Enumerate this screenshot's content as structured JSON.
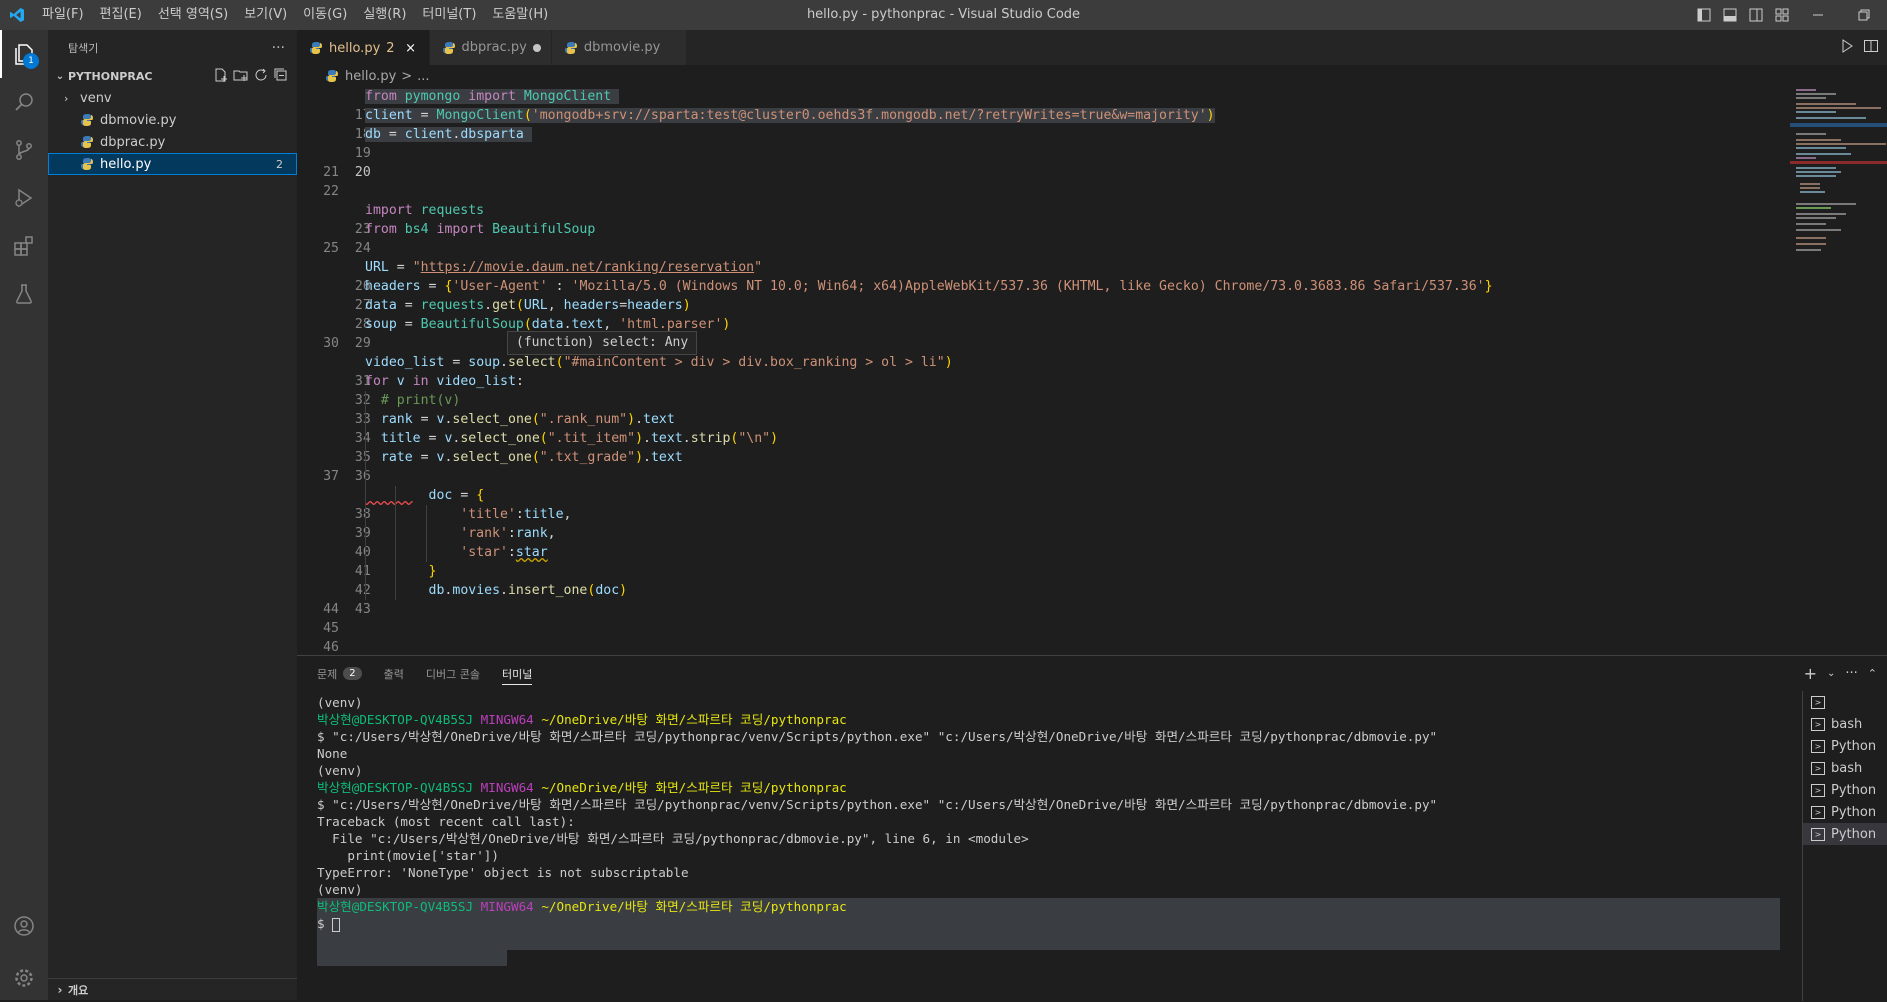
{
  "window": {
    "title": "hello.py - pythonprac - Visual Studio Code",
    "menu": [
      "파일(F)",
      "편집(E)",
      "선택 영역(S)",
      "보기(V)",
      "이동(G)",
      "실행(R)",
      "터미널(T)",
      "도움말(H)"
    ]
  },
  "activity": {
    "explorer_badge": "1"
  },
  "sidebar": {
    "header": "탐색기",
    "more": "···",
    "section": "PYTHONPRAC",
    "items": [
      {
        "label": "venv"
      },
      {
        "label": "dbmovie.py"
      },
      {
        "label": "dbprac.py"
      },
      {
        "label": "hello.py",
        "count": "2"
      }
    ],
    "outline": "개요"
  },
  "tabs": [
    {
      "label": "hello.py",
      "badge": "2",
      "close": "×"
    },
    {
      "label": "dbprac.py"
    },
    {
      "label": "dbmovie.py"
    }
  ],
  "breadcrumb": {
    "file": "hello.py",
    "sep": ">",
    "rest": "..."
  },
  "code": {
    "lines": [
      {
        "n": "17",
        "t": "from pymongo import MongoClient"
      },
      {
        "n": "18",
        "t": "client = MongoClient('mongodb+srv://sparta:test@cluster0.oehds3f.mongodb.net/?retryWrites=true&w=majority')"
      },
      {
        "n": "19",
        "t": "db = client.dbsparta"
      },
      {
        "n": "20",
        "t": ""
      },
      {
        "n": "21",
        "t": ""
      },
      {
        "n": "22",
        "t": ""
      },
      {
        "n": "23",
        "t": "import requests"
      },
      {
        "n": "24",
        "t": "from bs4 import BeautifulSoup"
      },
      {
        "n": "25",
        "t": ""
      },
      {
        "n": "26",
        "t": "URL = \"https://movie.daum.net/ranking/reservation\""
      },
      {
        "n": "27",
        "t": "headers = {'User-Agent' : 'Mozilla/5.0 (Windows NT 10.0; Win64; x64)AppleWebKit/537.36 (KHTML, like Gecko) Chrome/73.0.3683.86 Safari/537.36'}"
      },
      {
        "n": "28",
        "t": "data = requests.get(URL, headers=headers)"
      },
      {
        "n": "29",
        "t": "soup = BeautifulSoup(data.text, 'html.parser')"
      },
      {
        "n": "30",
        "t": ""
      },
      {
        "n": "31",
        "t": "video_list = soup.select(\"#mainContent > div > div.box_ranking > ol > li\")"
      },
      {
        "n": "32",
        "t": "for v in video_list:"
      },
      {
        "n": "33",
        "t": "  # print(v)"
      },
      {
        "n": "34",
        "t": "  rank = v.select_one(\".rank_num\").text"
      },
      {
        "n": "35",
        "t": "  title = v.select_one(\".tit_item\").text.strip(\"\\n\")"
      },
      {
        "n": "36",
        "t": "  rate = v.select_one(\".txt_grade\").text"
      },
      {
        "n": "37",
        "t": ""
      },
      {
        "n": "38",
        "t": "        doc = {"
      },
      {
        "n": "39",
        "t": "            'title':title,"
      },
      {
        "n": "40",
        "t": "            'rank':rank,"
      },
      {
        "n": "41",
        "t": "            'star':star"
      },
      {
        "n": "42",
        "t": "        }"
      },
      {
        "n": "43",
        "t": "        db.movies.insert_one(doc)"
      },
      {
        "n": "44",
        "t": ""
      },
      {
        "n": "45",
        "t": ""
      },
      {
        "n": "46",
        "t": ""
      }
    ],
    "hover": "(function) select: Any"
  },
  "panel": {
    "tabs": [
      {
        "label": "문제",
        "count": "2"
      },
      {
        "label": "출력"
      },
      {
        "label": "디버그 콘솔"
      },
      {
        "label": "터미널"
      }
    ],
    "terminal": {
      "venv": "(venv)",
      "user": "박상현@DESKTOP-QV4B5SJ",
      "shell": "MINGW64",
      "path": "~/OneDrive/바탕 화면/스파르타 코딩/pythonprac",
      "cmd": "$ \"c:/Users/박상현/OneDrive/바탕 화면/스파르타 코딩/pythonprac/venv/Scripts/python.exe\" \"c:/Users/박상현/OneDrive/바탕 화면/스파르타 코딩/pythonprac/dbmovie.py\"",
      "none": "None",
      "tb1": "Traceback (most recent call last):",
      "tb2": "  File \"c:/Users/박상현/OneDrive/바탕 화면/스파르타 코딩/pythonprac/dbmovie.py\", line 6, in <module>",
      "tb3": "    print(movie['star'])",
      "tb4": "TypeError: 'NoneType' object is not subscriptable",
      "prompt": "$ "
    },
    "terminal_list": [
      "bash",
      "Python",
      "bash",
      "Python",
      "Python",
      "Python"
    ]
  }
}
